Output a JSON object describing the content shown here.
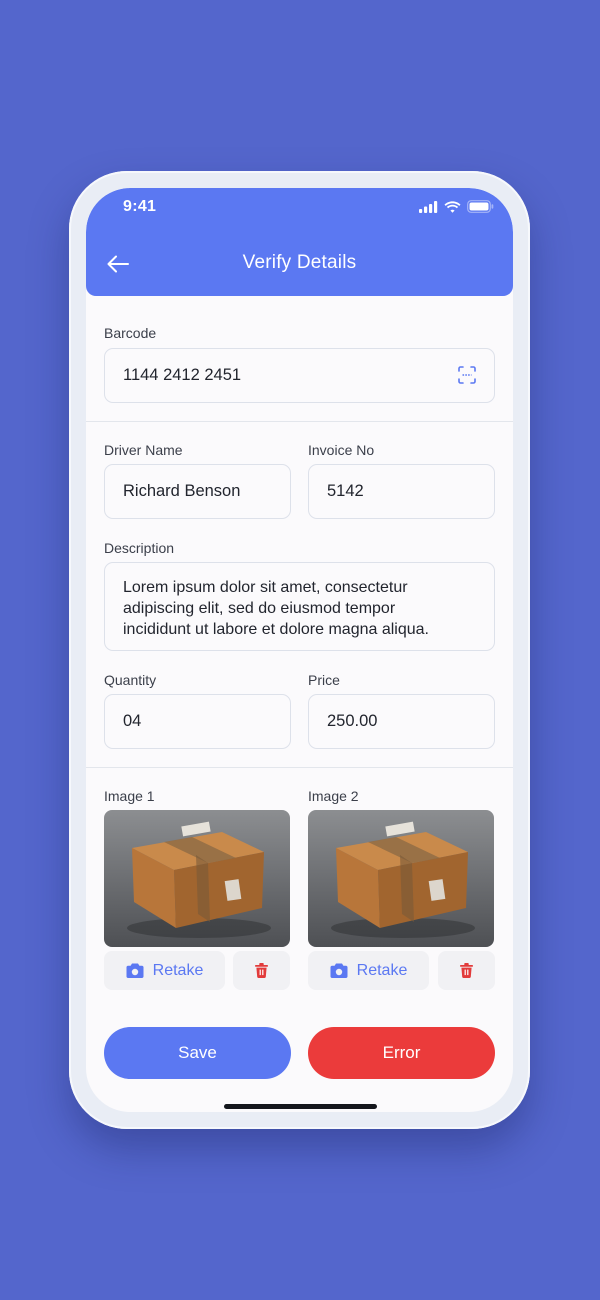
{
  "status_bar": {
    "time": "9:41",
    "icons": [
      "signal-icon",
      "wifi-icon",
      "battery-icon"
    ]
  },
  "header": {
    "title": "Verify Details",
    "back_icon": "arrow-left-icon",
    "background_color": "#5B78F2"
  },
  "form": {
    "barcode": {
      "label": "Barcode",
      "value": "1144 2412 2451",
      "icon": "barcode-scan-icon"
    },
    "driver_name": {
      "label": "Driver Name",
      "value": "Richard Benson"
    },
    "invoice_no": {
      "label": "Invoice No",
      "value": "5142"
    },
    "description": {
      "label": "Description",
      "lines": [
        "Lorem ipsum dolor sit amet, consectetur",
        "adipiscing elit, sed do eiusmod tempor",
        "incididunt ut labore et dolore magna aliqua."
      ]
    },
    "quantity": {
      "label": "Quantity",
      "value": "04"
    },
    "price": {
      "label": "Price",
      "value": "250.00"
    }
  },
  "images": [
    {
      "label": "Image 1",
      "retake_label": "Retake",
      "retake_icon": "camera-icon",
      "delete_icon": "trash-icon"
    },
    {
      "label": "Image 2",
      "retake_label": "Retake",
      "retake_icon": "camera-icon",
      "delete_icon": "trash-icon"
    }
  ],
  "actions": {
    "save_label": "Save",
    "error_label": "Error"
  },
  "colors": {
    "page_background": "#5466CC",
    "accent": "#5B78F2",
    "error": "#EB3B3B",
    "delete_icon": "#E23B3B"
  }
}
